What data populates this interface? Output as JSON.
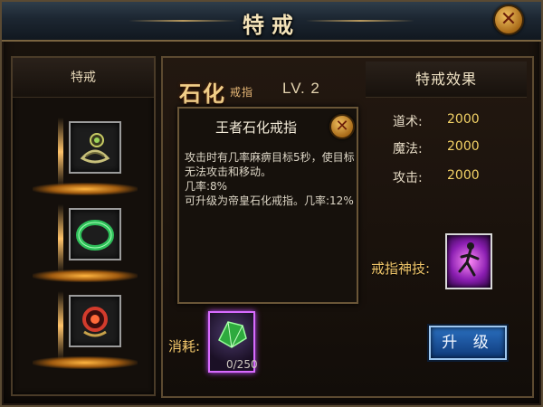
{
  "window": {
    "title": "特戒"
  },
  "left_panel": {
    "header": "特戒",
    "items": [
      "paralysis-ring",
      "green-bangle",
      "red-ring"
    ]
  },
  "ring": {
    "name": "石化",
    "subtitle": "戒指",
    "level": "LV. 2"
  },
  "tooltip": {
    "title": "王者石化戒指",
    "description": "攻击时有几率麻痹目标5秒，使目标无法攻击和移动。\n几率:8%\n可升级为帝皇石化戒指。几率:12%"
  },
  "effects": {
    "header": "特戒效果",
    "stats": [
      {
        "label": "道术:",
        "value": "2000"
      },
      {
        "label": "魔法:",
        "value": "2000"
      },
      {
        "label": "攻击:",
        "value": "2000"
      }
    ]
  },
  "skill": {
    "label": "戒指神技:"
  },
  "consume": {
    "label": "消耗:",
    "count": "0/250"
  },
  "upgrade": {
    "label": "升 级"
  },
  "colors": {
    "gold": "#f2c76b",
    "accent_blue": "#2a6fbf",
    "purple": "#d86bff"
  }
}
